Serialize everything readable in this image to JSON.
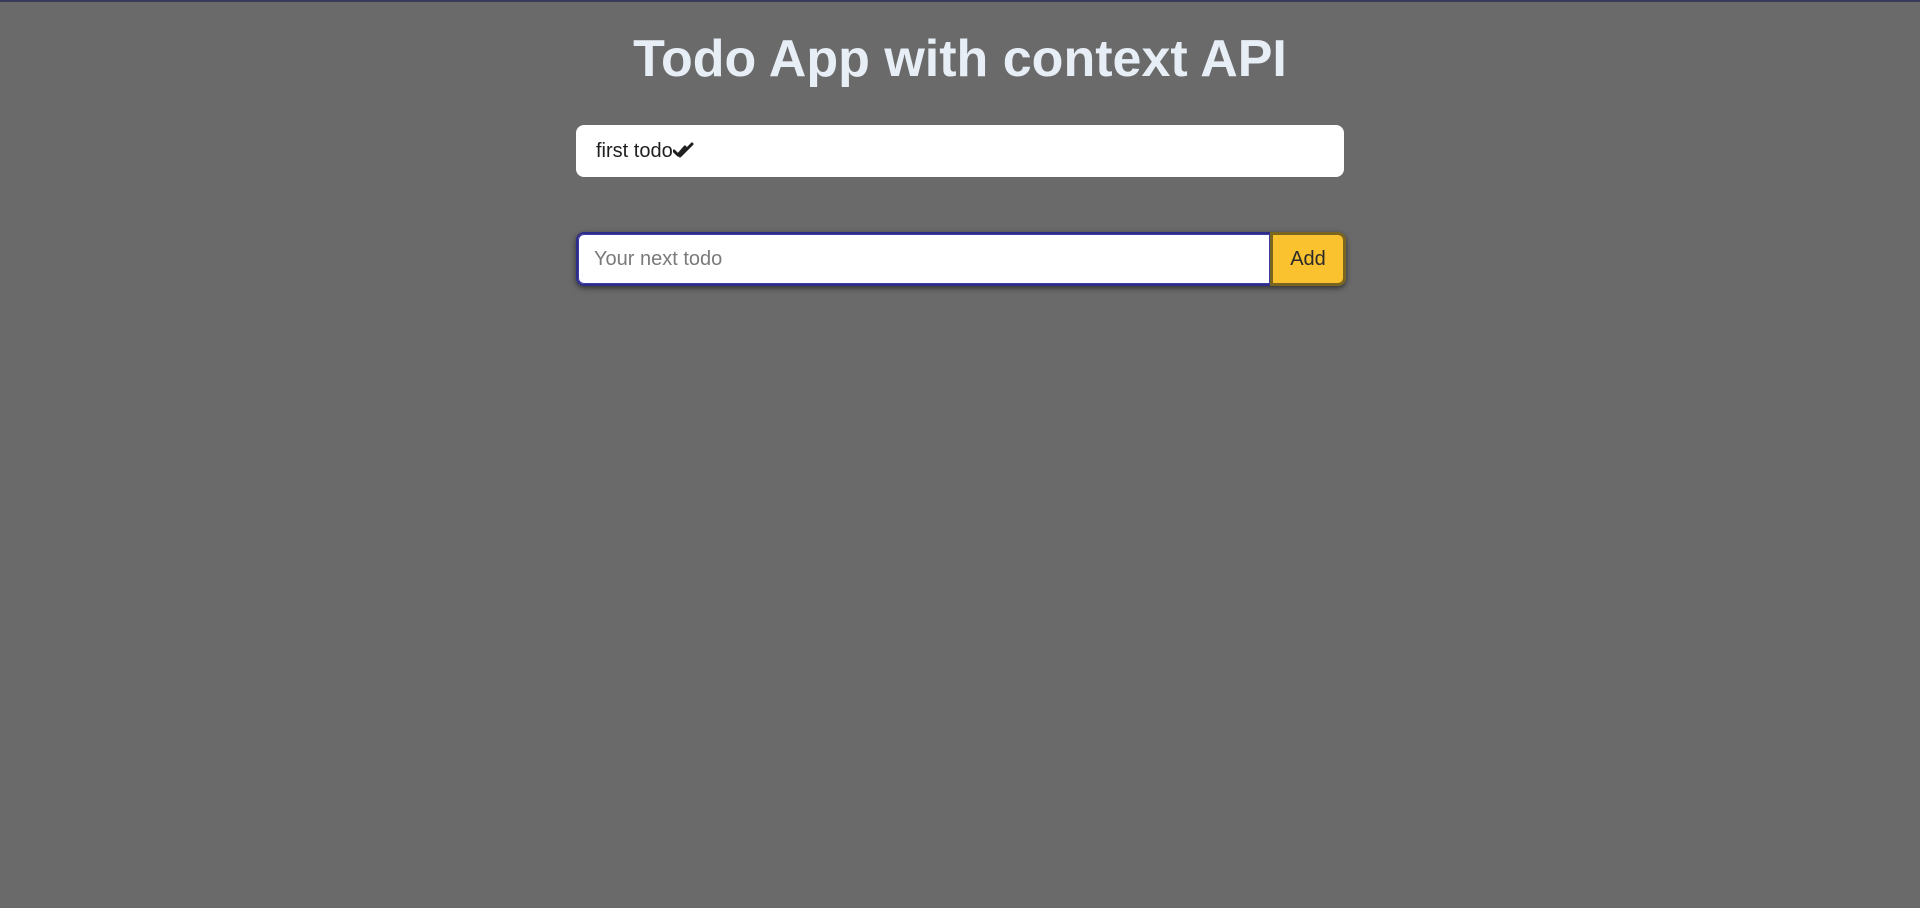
{
  "header": {
    "title": "Todo App with context API"
  },
  "todos": [
    {
      "text": "first todo",
      "icon": "double-check-icon"
    }
  ],
  "form": {
    "input_value": "",
    "input_placeholder": "Your next todo",
    "add_label": "Add"
  },
  "colors": {
    "background": "#6a6a6a",
    "title": "#e8eef6",
    "add_button": "#f9c22e",
    "input_focus_border": "#2e2e8a"
  }
}
